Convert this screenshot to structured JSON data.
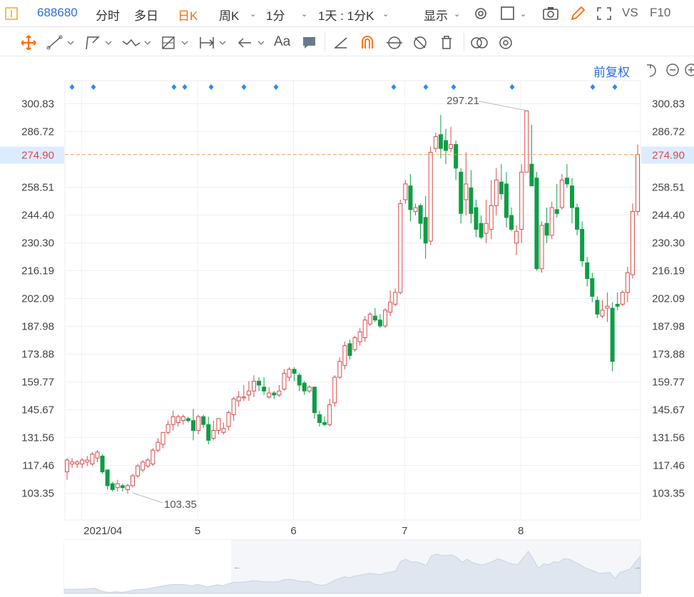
{
  "toolbar": {
    "stock_code": "688680",
    "items": [
      {
        "label": "分时",
        "active": false
      },
      {
        "label": "多日",
        "active": false
      },
      {
        "label": "日K",
        "active": true
      },
      {
        "label": "周K",
        "active": false
      },
      {
        "label": "1分",
        "active": false
      },
      {
        "label": "1天 : 1分K",
        "active": false
      },
      {
        "label": "显示",
        "active": false
      }
    ],
    "right_labels": [
      "VS",
      "F10"
    ],
    "font_label": "Aa"
  },
  "adjust_label": "前复权",
  "colors": {
    "up": "#d84b4b",
    "down": "#0f9d46",
    "accent": "#ff6a00",
    "blue": "#2b6fdf",
    "current_line": "#f0a050",
    "marker": "#2b8cf0"
  },
  "chart_data": {
    "type": "candlestick",
    "y_ticks": [
      "300.83",
      "286.72",
      "274.90",
      "258.51",
      "244.40",
      "230.30",
      "216.19",
      "202.09",
      "187.98",
      "173.88",
      "159.77",
      "145.67",
      "131.56",
      "117.46",
      "103.35"
    ],
    "y_tick_values": [
      300.83,
      286.72,
      274.9,
      258.51,
      244.4,
      230.3,
      216.19,
      202.09,
      187.98,
      173.88,
      159.77,
      145.67,
      131.56,
      117.46,
      103.35
    ],
    "x_ticks": [
      "2021/04",
      "5",
      "6",
      "7",
      "8"
    ],
    "current_price": "274.90",
    "max_label": "297.21",
    "min_label": "103.35",
    "candles": [
      [
        114,
        120,
        110,
        121
      ],
      [
        118,
        119,
        116,
        121
      ],
      [
        118,
        119,
        116,
        120
      ],
      [
        118,
        120,
        116,
        121
      ],
      [
        119,
        120,
        117,
        122
      ],
      [
        118,
        123,
        117,
        124
      ],
      [
        121,
        124,
        119,
        125
      ],
      [
        122,
        114,
        113,
        123
      ],
      [
        115,
        107,
        105,
        115
      ],
      [
        108,
        105,
        104,
        109
      ],
      [
        106,
        108,
        104,
        110
      ],
      [
        107,
        106,
        104,
        108
      ],
      [
        105,
        107,
        103,
        108
      ],
      [
        107,
        112,
        106,
        113
      ],
      [
        112,
        117,
        111,
        118
      ],
      [
        115,
        119,
        114,
        120
      ],
      [
        117,
        120,
        116,
        121
      ],
      [
        118,
        125,
        117,
        126
      ],
      [
        125,
        129,
        124,
        131
      ],
      [
        128,
        134,
        126,
        134
      ],
      [
        134,
        138,
        133,
        140
      ],
      [
        138,
        142,
        135,
        145
      ],
      [
        139,
        142,
        137,
        143
      ],
      [
        140,
        142,
        138,
        143
      ],
      [
        141,
        140,
        139,
        142
      ],
      [
        140,
        135,
        130,
        146
      ],
      [
        135,
        142,
        133,
        143
      ],
      [
        142,
        138,
        136,
        143
      ],
      [
        138,
        130,
        128,
        142
      ],
      [
        131,
        135,
        130,
        140
      ],
      [
        135,
        141,
        133,
        141
      ],
      [
        134,
        136,
        133,
        139
      ],
      [
        137,
        144,
        135,
        145
      ],
      [
        143,
        151,
        140,
        152
      ],
      [
        150,
        152,
        147,
        155
      ],
      [
        152,
        152,
        150,
        158
      ],
      [
        153,
        155,
        150,
        160
      ],
      [
        155,
        160,
        152,
        163
      ],
      [
        160,
        158,
        155,
        162
      ],
      [
        157,
        155,
        153,
        162
      ],
      [
        152,
        154,
        151,
        157
      ],
      [
        154,
        153,
        151,
        155
      ],
      [
        153,
        155,
        152,
        158
      ],
      [
        156,
        164,
        155,
        166
      ],
      [
        162,
        166,
        160,
        167
      ],
      [
        166,
        164,
        160,
        167
      ],
      [
        163,
        158,
        155,
        164
      ],
      [
        159,
        155,
        153,
        160
      ],
      [
        155,
        157,
        154,
        158
      ],
      [
        157,
        144,
        141,
        157
      ],
      [
        143,
        139,
        137,
        145
      ],
      [
        139,
        138,
        137,
        142
      ],
      [
        138,
        148,
        137,
        151
      ],
      [
        149,
        162,
        147,
        163
      ],
      [
        162,
        170,
        161,
        172
      ],
      [
        168,
        178,
        166,
        180
      ],
      [
        179,
        173,
        171,
        181
      ],
      [
        176,
        182,
        175,
        183
      ],
      [
        180,
        185,
        178,
        187
      ],
      [
        182,
        191,
        180,
        193
      ],
      [
        189,
        194,
        188,
        195
      ],
      [
        193,
        191,
        190,
        197
      ],
      [
        191,
        188,
        187,
        194
      ],
      [
        188,
        196,
        187,
        197
      ],
      [
        195,
        200,
        193,
        206
      ],
      [
        199,
        205,
        198,
        207
      ],
      [
        205,
        250,
        204,
        252
      ],
      [
        252,
        260,
        250,
        262
      ],
      [
        259,
        247,
        241,
        265
      ],
      [
        246,
        248,
        244,
        250
      ],
      [
        249,
        240,
        232,
        250
      ],
      [
        243,
        230,
        222,
        254
      ],
      [
        231,
        276,
        229,
        279
      ],
      [
        278,
        284,
        276,
        286
      ],
      [
        285,
        278,
        273,
        295
      ],
      [
        282,
        277,
        270,
        288
      ],
      [
        278,
        280,
        276,
        289
      ],
      [
        280,
        268,
        262,
        282
      ],
      [
        266,
        245,
        240,
        268
      ],
      [
        252,
        260,
        244,
        276
      ],
      [
        258,
        245,
        240,
        267
      ],
      [
        248,
        237,
        233,
        252
      ],
      [
        240,
        233,
        232,
        244
      ],
      [
        235,
        240,
        230,
        252
      ],
      [
        237,
        249,
        232,
        262
      ],
      [
        249,
        262,
        244,
        268
      ],
      [
        261,
        255,
        252,
        270
      ],
      [
        260,
        243,
        238,
        266
      ],
      [
        244,
        237,
        236,
        248
      ],
      [
        230,
        236,
        224,
        239
      ],
      [
        237,
        266,
        230,
        270
      ],
      [
        266,
        297,
        268,
        297
      ],
      [
        270,
        259,
        265,
        290
      ],
      [
        263,
        217,
        216,
        266
      ],
      [
        217,
        239,
        215,
        241
      ],
      [
        240,
        234,
        230,
        248
      ],
      [
        234,
        248,
        232,
        251
      ],
      [
        247,
        245,
        243,
        260
      ],
      [
        248,
        262,
        247,
        265
      ],
      [
        263,
        260,
        258,
        270
      ],
      [
        259,
        248,
        240,
        263
      ],
      [
        248,
        237,
        234,
        250
      ],
      [
        237,
        221,
        218,
        241
      ],
      [
        220,
        212,
        208,
        223
      ],
      [
        212,
        203,
        200,
        215
      ],
      [
        201,
        194,
        192,
        203
      ],
      [
        193,
        196,
        192,
        201
      ],
      [
        197,
        198,
        190,
        205
      ],
      [
        197,
        170,
        165,
        200
      ],
      [
        199,
        198,
        196,
        205
      ],
      [
        199,
        205,
        198,
        206
      ],
      [
        205,
        215,
        200,
        218
      ],
      [
        214,
        246,
        212,
        250
      ],
      [
        246,
        275,
        244,
        280
      ]
    ]
  }
}
